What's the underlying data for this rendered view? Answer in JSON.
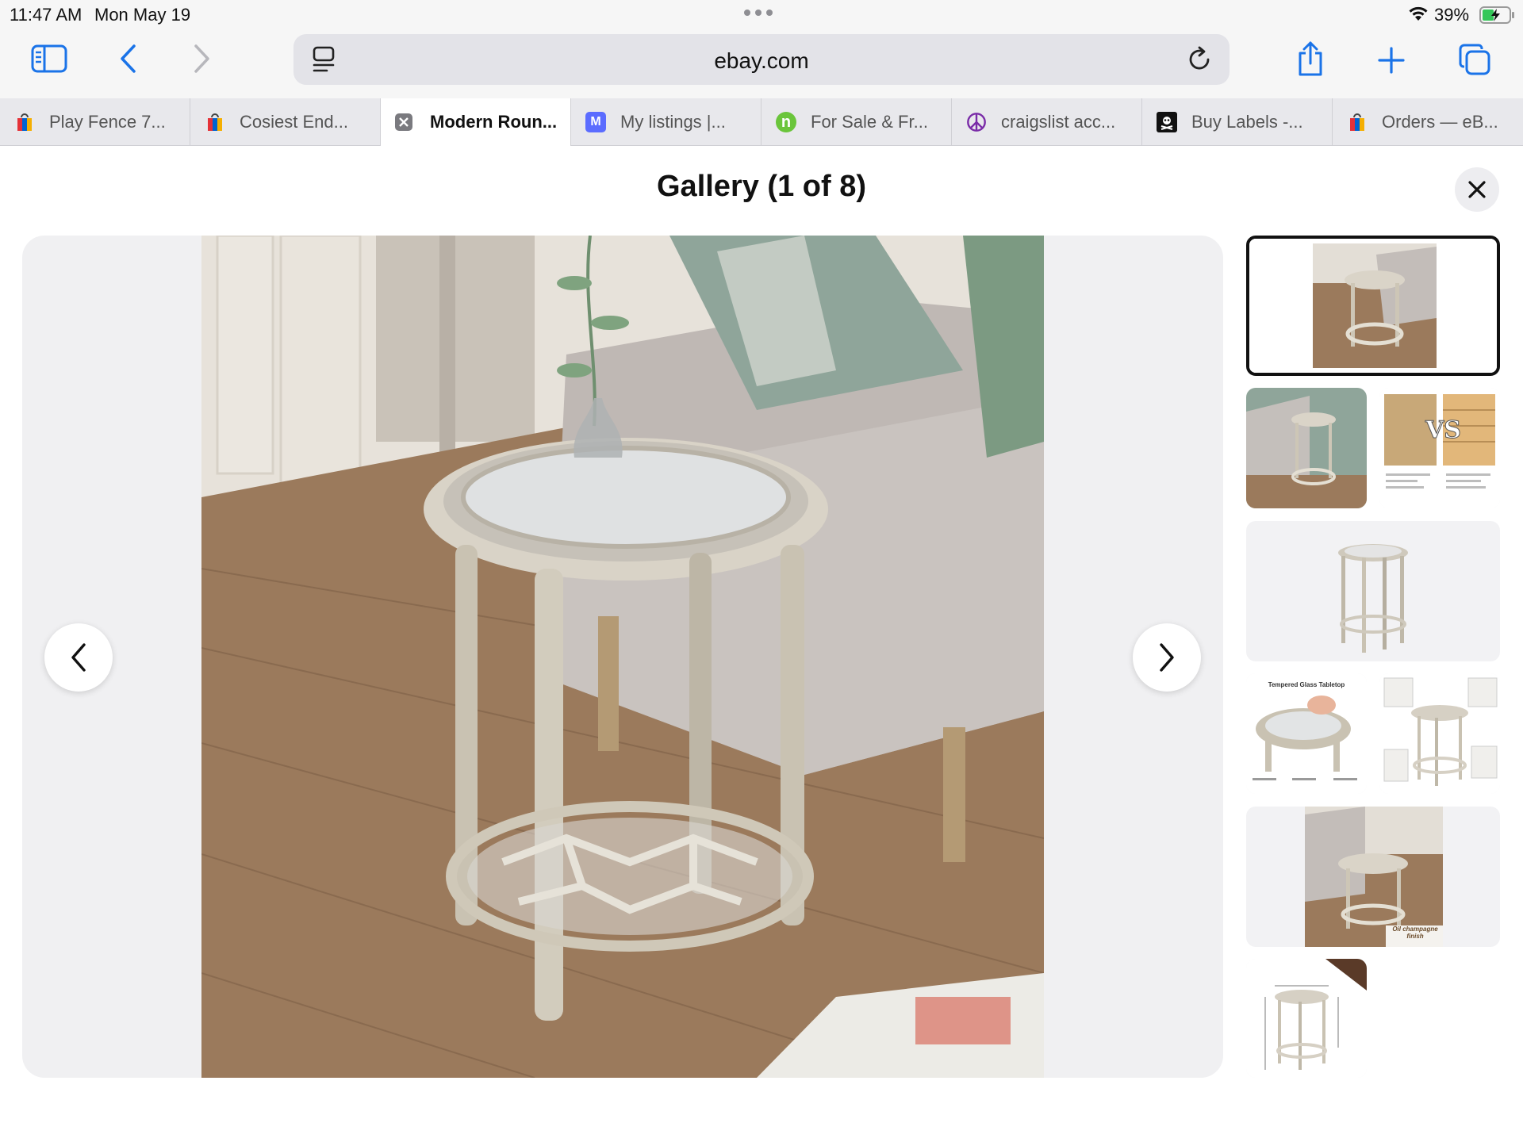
{
  "status_bar": {
    "time": "11:47 AM",
    "date": "Mon May 19",
    "battery": "39%",
    "wifi_icon": "wifi-icon",
    "battery_icon": "battery-charging-icon"
  },
  "toolbar": {
    "url": "ebay.com",
    "icons": [
      "sidebar-icon",
      "back-icon",
      "forward-icon",
      "reader-icon",
      "reload-icon",
      "share-icon",
      "new-tab-icon",
      "tabs-overview-icon"
    ]
  },
  "tabs": [
    {
      "label": "Play Fence 7...",
      "favicon": "ebay-bag-icon"
    },
    {
      "label": "Cosiest End...",
      "favicon": "ebay-bag-icon"
    },
    {
      "label": "Modern Roun...",
      "favicon": "close-tab-icon",
      "active": true
    },
    {
      "label": "My listings |...",
      "favicon": "mercari-icon",
      "favicon_text": "M"
    },
    {
      "label": "For Sale & Fr...",
      "favicon": "nextdoor-icon",
      "favicon_text": "n"
    },
    {
      "label": "craigslist acc...",
      "favicon": "craigslist-peace-icon"
    },
    {
      "label": "Buy Labels -...",
      "favicon": "pirate-ship-icon"
    },
    {
      "label": "Orders — eB...",
      "favicon": "ebay-bag-icon"
    }
  ],
  "gallery": {
    "title": "Gallery (1 of 8)",
    "current": 1,
    "total": 8,
    "thumbnails": [
      {
        "overlay_text": ""
      },
      {
        "overlay_text": ""
      },
      {
        "overlay_text": "VS"
      },
      {
        "overlay_text": ""
      },
      {
        "overlay_text": "Tempered Glass Tabletop"
      },
      {
        "overlay_text": ""
      },
      {
        "overlay_text": "Oil champagne finish"
      },
      {
        "overlay_text": ""
      }
    ]
  },
  "colors": {
    "chrome_bg": "#f6f6f6",
    "tab_bar_bg": "#e8e8ec",
    "ios_blue": "#1a73e8",
    "ebay_red": "#e53238",
    "ebay_blue": "#0064d2",
    "ebay_yellow": "#f5af02",
    "ebay_green": "#86b817"
  }
}
